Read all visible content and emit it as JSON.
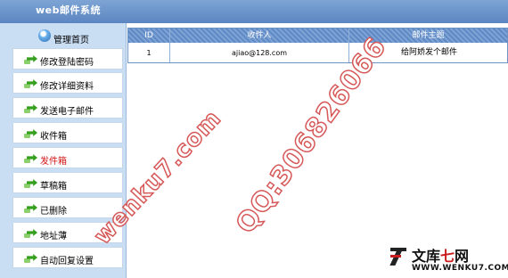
{
  "header": {
    "title": "web邮件系统"
  },
  "sidebar": {
    "home_label": "管理首页",
    "items": [
      {
        "label": "修改登陆密码",
        "active": false
      },
      {
        "label": "修改详细资料",
        "active": false
      },
      {
        "label": "发送电子邮件",
        "active": false
      },
      {
        "label": "收件箱",
        "active": false
      },
      {
        "label": "发件箱",
        "active": true
      },
      {
        "label": "草稿箱",
        "active": false
      },
      {
        "label": "已删除",
        "active": false
      },
      {
        "label": "地址薄",
        "active": false
      },
      {
        "label": "自动回复设置",
        "active": false
      }
    ]
  },
  "table": {
    "columns": [
      "ID",
      "收件人",
      "邮件主题"
    ],
    "rows": [
      {
        "id": "1",
        "recipient": "ajiao@128.com",
        "subject": "给阿娇发个邮件"
      }
    ]
  },
  "watermark": {
    "site": "wenku7.com",
    "qq": "QQ:306826066"
  },
  "logo": {
    "text_a": "文库",
    "text_b": "七",
    "text_c": "网",
    "url": "WWW.WENKU7.COM"
  },
  "colors": {
    "header": "#6a93cb",
    "sidebar": "#c9ddf3",
    "active_item": "#d21414",
    "table_header": "#6d93c4"
  },
  "icons": {
    "home": "globe-icon",
    "menu": "green-arrow-icon"
  }
}
